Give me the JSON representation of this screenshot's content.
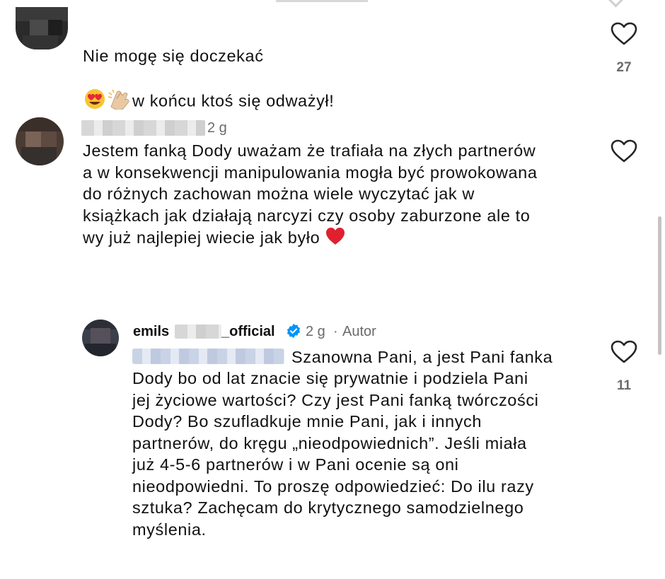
{
  "comments": [
    {
      "text": "Nie mogę się doczekać",
      "text_after": "w końcu ktoś się odważył!",
      "likes": "27",
      "emojis": [
        "heart-eyes-emoji",
        "clapping-hands-emoji"
      ]
    },
    {
      "time": "2 g",
      "text": "Jestem fanką Dody uważam że trafiała na złych partnerów\na w konsekwencji manipulowania mogła być prowokowana\ndo różnych zachowan można wiele wyczytać jak w\nksiążkach jak działają narcyzi czy osoby zaburzone ale to\nwy już najlepiej wiecie jak było",
      "emoji": "red-heart-emoji"
    }
  ],
  "reply": {
    "username_start": "emils",
    "username_end": "_official",
    "time": "2 g",
    "separator": "·",
    "author_badge": "Autor",
    "likes": "11",
    "text_first_line": "Szanowna Pani, a jest Pani fanka",
    "text_rest": "Dody bo od lat znacie się prywatnie i podziela Pani\njej życiowe wartości? Czy jest Pani fanką twórczości\nDody? Bo szufladkuje mnie Pani, jak i innych\npartnerów, do kręgu „nieodpowiednich”. Jeśli miała\njuż 4-5-6 partnerów i w Pani ocenie są oni\nnieodpowiedni. To proszę odpowiedzieć: Do ilu razy\nsztuka? Zachęcam do krytycznego samodzielnego\nmyślenia."
  },
  "colors": {
    "text": "#111111",
    "meta": "#6b6b6b",
    "verified": "#0095f6",
    "heart_emoji": "#e0202e"
  }
}
